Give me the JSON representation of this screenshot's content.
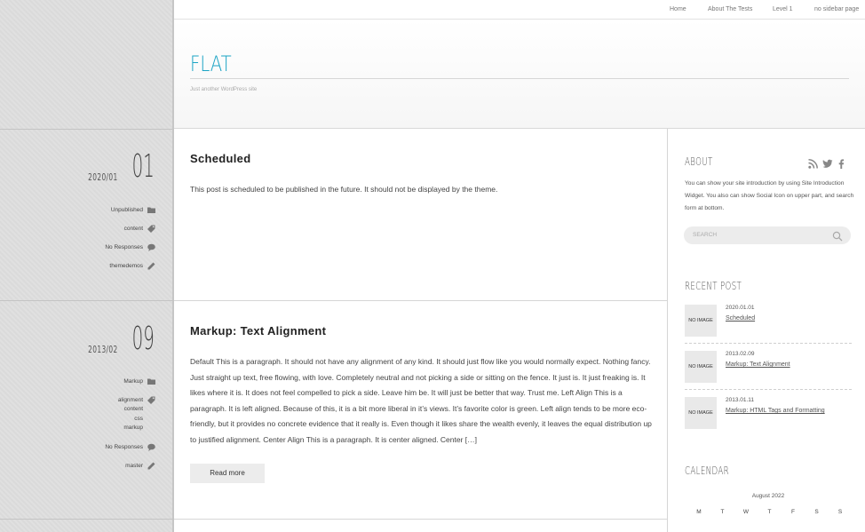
{
  "nav": {
    "items": [
      "Home",
      "About The Tests",
      "Level 1",
      "no sidebar page"
    ]
  },
  "header": {
    "site_title": "FLAT",
    "tagline": "Just another WordPress site"
  },
  "posts": [
    {
      "title": "Scheduled",
      "date_ym": "2020/01",
      "date_d": "01",
      "status": "Unpublished",
      "tags": "content",
      "comments": "No Responses",
      "author": "themedemos",
      "excerpt": "This post is scheduled to be published in the future. It should not be displayed by the theme."
    },
    {
      "title": "Markup: Text Alignment",
      "date_ym": "2013/02",
      "date_d": "09",
      "category": "Markup",
      "tags_lines": [
        "alignment",
        "content",
        "css",
        "markup"
      ],
      "comments": "No Responses",
      "author": "master",
      "excerpt": "Default This is a paragraph. It should not have any alignment of any kind. It should just flow like you would normally expect. Nothing fancy. Just straight up text, free flowing, with love. Completely neutral and not picking a side or sitting on the fence. It just is. It just freaking is. It likes where it is. It does not feel compelled to pick a side. Leave him be. It will just be better that way. Trust me. Left Align This is a paragraph. It is left aligned. Because of this, it is a bit more liberal in it’s views. It’s favorite color is green. Left align tends to be more eco-friendly, but it provides no concrete evidence that it really is. Even though it likes share the wealth evenly, it leaves the equal distribution up to justified alignment. Center Align This is a paragraph. It is center aligned. Center […]",
      "read_more": "Read more"
    }
  ],
  "sidebar": {
    "about_title": "About",
    "about_text": "You can show your site introduction by using Site Introduction Widget. You also can show Social Icon on upper part, and search form at bottom.",
    "search_placeholder": "SEARCH",
    "recent_title": "Recent Post",
    "recent": [
      {
        "thumb": "NO IMAGE",
        "date": "2020.01.01",
        "title": "Scheduled"
      },
      {
        "thumb": "NO IMAGE",
        "date": "2013.02.09",
        "title": "Markup: Text Alignment"
      },
      {
        "thumb": "NO IMAGE",
        "date": "2013.01.11",
        "title": "Markup: HTML Tags and Formatting"
      }
    ],
    "calendar_title": "Calendar",
    "calendar_caption": "August 2022",
    "calendar_heads": [
      "M",
      "T",
      "W",
      "T",
      "F",
      "S",
      "S"
    ]
  },
  "icons": {
    "status": "folder-icon",
    "tags": "tag-icon",
    "comments": "speech-bubble-icon",
    "author": "pencil-icon",
    "rss": "rss-icon",
    "twitter": "twitter-icon",
    "facebook": "facebook-icon",
    "search": "search-icon"
  },
  "colors": {
    "accent": "#1aa3c4",
    "left_column": "#dedede"
  }
}
